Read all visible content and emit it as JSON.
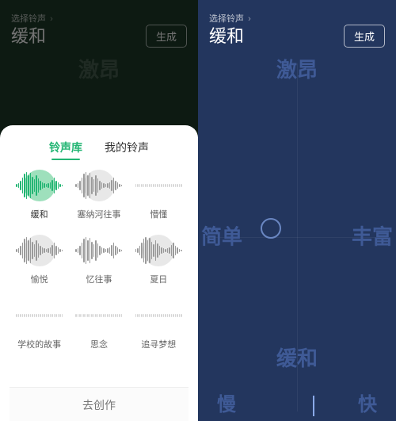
{
  "left": {
    "breadcrumb": "选择铃声",
    "chevron": "›",
    "title": "缓和",
    "generate": "生成",
    "moods": {
      "top": "激昂",
      "bottom": "",
      "left": "",
      "right": ""
    }
  },
  "right": {
    "breadcrumb": "选择铃声",
    "chevron": "›",
    "title": "缓和",
    "generate": "生成",
    "moods": {
      "top": "激昂",
      "bottom": "缓和",
      "left": "简单",
      "right": "丰富",
      "slow": "慢",
      "fast": "快"
    }
  },
  "sheet": {
    "tabs": {
      "library": "铃声库",
      "mine": "我的铃声",
      "active": "library"
    },
    "presets": [
      {
        "label": "缓和",
        "selected": true,
        "halo": true,
        "faint": false
      },
      {
        "label": "塞纳河往事",
        "selected": false,
        "halo": true,
        "faint": false
      },
      {
        "label": "懵懂",
        "selected": false,
        "halo": false,
        "faint": true
      },
      {
        "label": "愉悦",
        "selected": false,
        "halo": true,
        "faint": false
      },
      {
        "label": "忆往事",
        "selected": false,
        "halo": false,
        "faint": false
      },
      {
        "label": "夏日",
        "selected": false,
        "halo": true,
        "faint": false
      },
      {
        "label": "学校的故事",
        "selected": false,
        "halo": false,
        "faint": true
      },
      {
        "label": "思念",
        "selected": false,
        "halo": false,
        "faint": true
      },
      {
        "label": "追寻梦想",
        "selected": false,
        "halo": false,
        "faint": true
      }
    ],
    "footer": "去创作"
  },
  "colors": {
    "accent_green": "#22b573",
    "accent_blue": "#3f5a96"
  }
}
